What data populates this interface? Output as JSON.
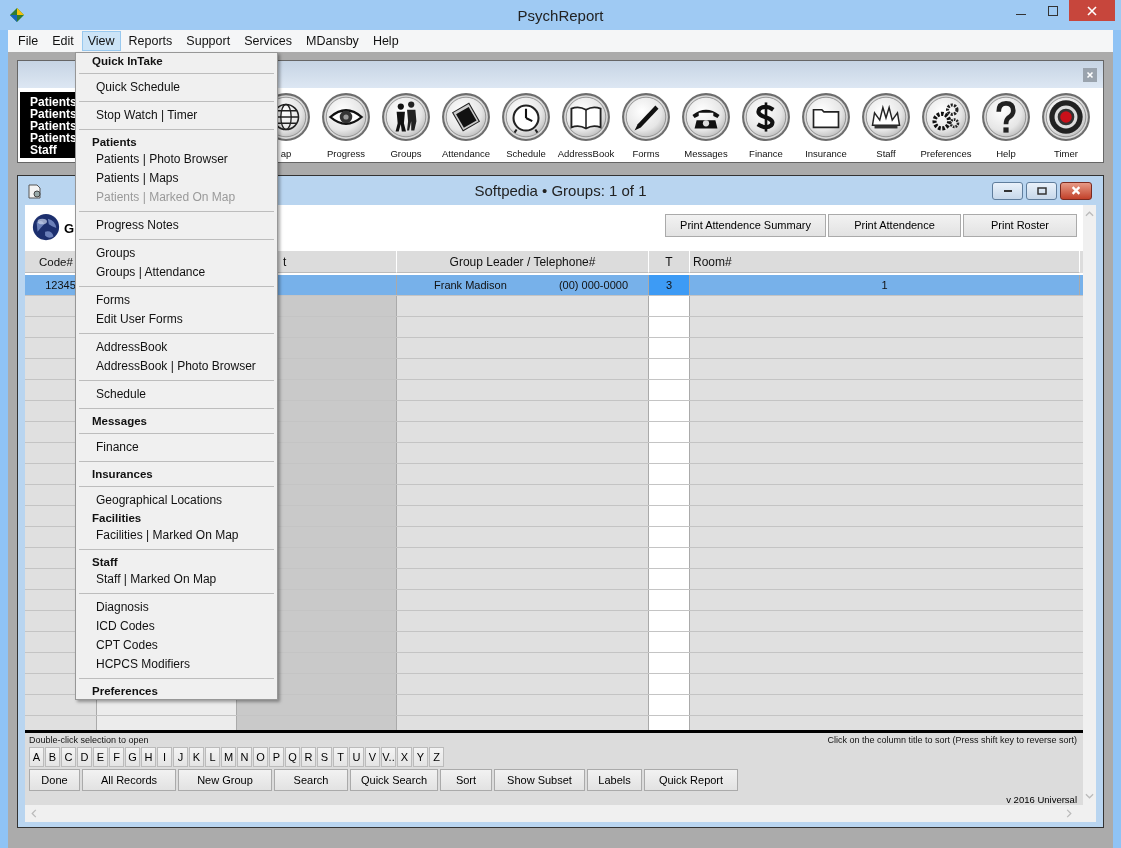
{
  "window": {
    "title": "PsychReport"
  },
  "menu_bar": [
    {
      "label": "File",
      "selected": false
    },
    {
      "label": "Edit",
      "selected": false
    },
    {
      "label": "View",
      "selected": true
    },
    {
      "label": "Reports",
      "selected": false
    },
    {
      "label": "Support",
      "selected": false
    },
    {
      "label": "Services",
      "selected": false
    },
    {
      "label": "MDansby",
      "selected": false
    },
    {
      "label": "Help",
      "selected": false
    }
  ],
  "view_menu": {
    "items": [
      {
        "kind": "heading",
        "label": "Quick InTake",
        "disabled": false
      },
      {
        "kind": "separator"
      },
      {
        "kind": "item",
        "label": "Quick Schedule",
        "disabled": false
      },
      {
        "kind": "separator"
      },
      {
        "kind": "item",
        "label": "Stop Watch | Timer",
        "disabled": false
      },
      {
        "kind": "separator"
      },
      {
        "kind": "heading",
        "label": "Patients",
        "disabled": false
      },
      {
        "kind": "item",
        "label": "Patients | Photo Browser",
        "disabled": false
      },
      {
        "kind": "item",
        "label": "Patients | Maps",
        "disabled": false
      },
      {
        "kind": "item",
        "label": "Patients | Marked On Map",
        "disabled": true
      },
      {
        "kind": "separator"
      },
      {
        "kind": "item",
        "label": "Progress Notes",
        "disabled": false
      },
      {
        "kind": "separator"
      },
      {
        "kind": "item",
        "label": "Groups",
        "disabled": false
      },
      {
        "kind": "item",
        "label": "Groups | Attendance",
        "disabled": false
      },
      {
        "kind": "separator"
      },
      {
        "kind": "item",
        "label": "Forms",
        "disabled": false
      },
      {
        "kind": "item",
        "label": "Edit User Forms",
        "disabled": false
      },
      {
        "kind": "separator"
      },
      {
        "kind": "item",
        "label": "AddressBook",
        "disabled": false
      },
      {
        "kind": "item",
        "label": "AddressBook | Photo Browser",
        "disabled": false
      },
      {
        "kind": "separator"
      },
      {
        "kind": "item",
        "label": "Schedule",
        "disabled": false
      },
      {
        "kind": "separator"
      },
      {
        "kind": "heading",
        "label": "Messages",
        "disabled": false
      },
      {
        "kind": "separator"
      },
      {
        "kind": "item",
        "label": "Finance",
        "disabled": false
      },
      {
        "kind": "separator"
      },
      {
        "kind": "heading",
        "label": "Insurances",
        "disabled": false
      },
      {
        "kind": "separator"
      },
      {
        "kind": "item",
        "label": "Geographical Locations",
        "disabled": false
      },
      {
        "kind": "heading",
        "label": "Facilities",
        "disabled": false
      },
      {
        "kind": "item",
        "label": "Facilities | Marked On Map",
        "disabled": false
      },
      {
        "kind": "separator"
      },
      {
        "kind": "heading",
        "label": "Staff",
        "disabled": false
      },
      {
        "kind": "item",
        "label": "Staff | Marked On Map",
        "disabled": false
      },
      {
        "kind": "separator"
      },
      {
        "kind": "item",
        "label": "Diagnosis",
        "disabled": false
      },
      {
        "kind": "item",
        "label": "ICD Codes",
        "disabled": false
      },
      {
        "kind": "item",
        "label": "CPT Codes",
        "disabled": false
      },
      {
        "kind": "item",
        "label": "HCPCS Modifiers",
        "disabled": false
      },
      {
        "kind": "separator"
      },
      {
        "kind": "heading",
        "label": "Preferences",
        "disabled": false
      }
    ]
  },
  "toolbar": {
    "quick_list": [
      "Patients",
      "Patients",
      "Patients",
      "Patients",
      "Staff"
    ],
    "buttons": [
      {
        "label": "ap"
      },
      {
        "label": "Progress"
      },
      {
        "label": "Groups"
      },
      {
        "label": "Attendance"
      },
      {
        "label": "Schedule"
      },
      {
        "label": "AddressBook"
      },
      {
        "label": "Forms"
      },
      {
        "label": "Messages"
      },
      {
        "label": "Finance"
      },
      {
        "label": "Insurance"
      },
      {
        "label": "Staff"
      },
      {
        "label": "Preferences"
      },
      {
        "label": "Help"
      },
      {
        "label": "Timer"
      }
    ]
  },
  "child_window": {
    "title": "Softpedia • Groups: 1 of 1",
    "heading": "G",
    "print_buttons": [
      "Print Attendence Summary",
      "Print Attendence",
      "Print Roster"
    ],
    "table": {
      "columns": [
        "Code#",
        "t",
        "Group Leader / Telephone#",
        "T",
        "Room#"
      ],
      "rows": [
        {
          "selected": true,
          "code": "12345",
          "leader": "Frank Madison",
          "telephone": "(00) 000-0000",
          "t": "3",
          "room": "1"
        }
      ]
    },
    "open_hint": "Double-click selection to open",
    "sort_hint": "Click on the column title to sort (Press shift key to reverse sort)",
    "letters": [
      "A",
      "B",
      "C",
      "D",
      "E",
      "F",
      "G",
      "H",
      "I",
      "J",
      "K",
      "L",
      "M",
      "N",
      "O",
      "P",
      "Q",
      "R",
      "S",
      "T",
      "U",
      "V",
      "V..",
      "X",
      "Y",
      "Z"
    ],
    "actions": [
      "Done",
      "All Records",
      "New Group",
      "Search",
      "Quick Search",
      "Sort",
      "Show Subset",
      "Labels",
      "Quick Report"
    ],
    "version": "v 2016 Universal"
  }
}
